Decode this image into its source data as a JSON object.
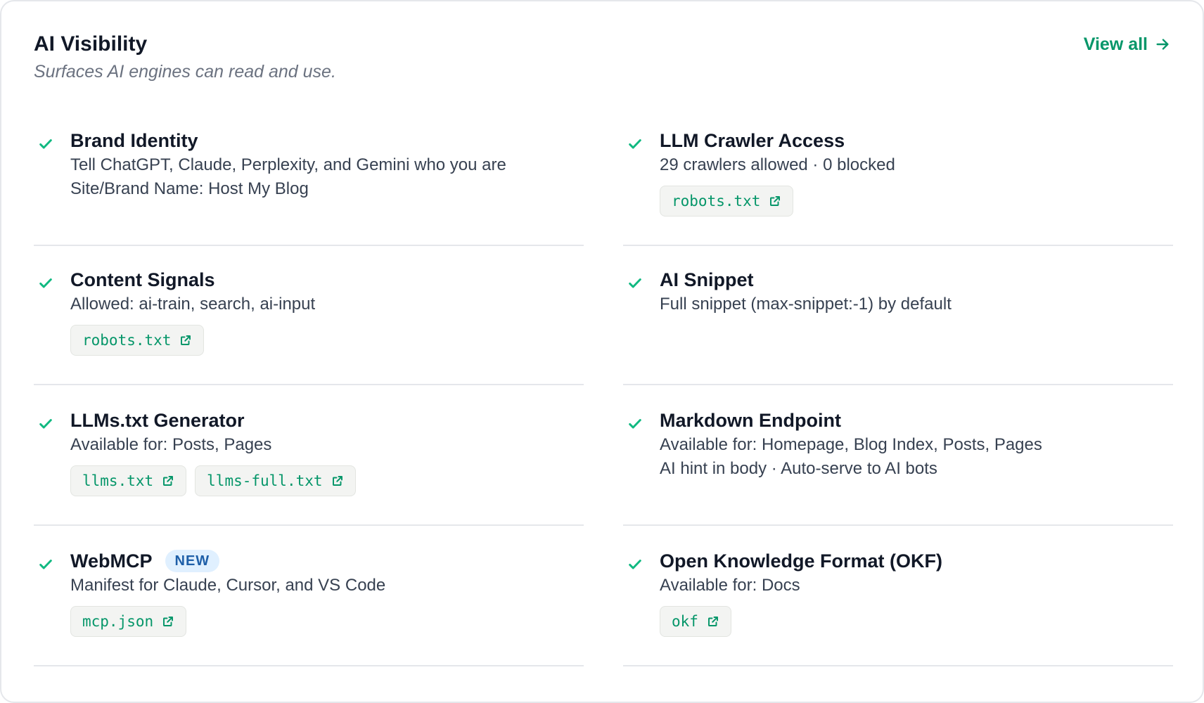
{
  "header": {
    "title": "AI Visibility",
    "subtitle": "Surfaces AI engines can read and use.",
    "view_all_label": "View all"
  },
  "colors": {
    "accent": "#059669",
    "badge_bg": "#e0f0ff",
    "badge_text": "#1e5fa8"
  },
  "items": [
    {
      "title": "Brand Identity",
      "lines": [
        "Tell ChatGPT, Claude, Perplexity, and Gemini who you are",
        "Site/Brand Name: Host My Blog"
      ],
      "links": []
    },
    {
      "title": "LLM Crawler Access",
      "lines": [
        "29 crawlers allowed · 0 blocked"
      ],
      "links": [
        "robots.txt"
      ]
    },
    {
      "title": "Content Signals",
      "lines": [
        "Allowed: ai-train, search, ai-input"
      ],
      "links": [
        "robots.txt"
      ]
    },
    {
      "title": "AI Snippet",
      "lines": [
        "Full snippet (max-snippet:-1) by default"
      ],
      "links": []
    },
    {
      "title": "LLMs.txt Generator",
      "lines": [
        "Available for: Posts, Pages"
      ],
      "links": [
        "llms.txt",
        "llms-full.txt"
      ]
    },
    {
      "title": "Markdown Endpoint",
      "lines": [
        "Available for: Homepage, Blog Index, Posts, Pages",
        "AI hint in body · Auto-serve to AI bots"
      ],
      "links": []
    },
    {
      "title": "WebMCP",
      "badge": "NEW",
      "lines": [
        "Manifest for Claude, Cursor, and VS Code"
      ],
      "links": [
        "mcp.json"
      ]
    },
    {
      "title": "Open Knowledge Format (OKF)",
      "lines": [
        "Available for: Docs"
      ],
      "links": [
        "okf"
      ]
    }
  ],
  "icons": {
    "status": "check-icon",
    "link": "external-link-icon",
    "view_all": "arrow-right-icon"
  }
}
